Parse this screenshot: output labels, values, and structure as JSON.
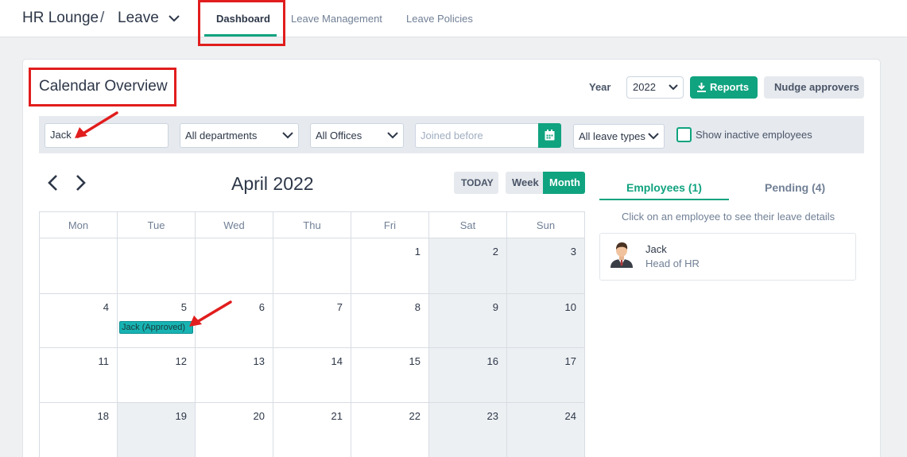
{
  "header": {
    "app_name": "HR Lounge",
    "separator": "/",
    "module": "Leave",
    "tabs": [
      {
        "label": "Dashboard",
        "active": true
      },
      {
        "label": "Leave Management",
        "active": false
      },
      {
        "label": "Leave Policies",
        "active": false
      }
    ]
  },
  "page": {
    "title": "Calendar Overview",
    "year_label": "Year",
    "year_value": "2022",
    "reports_label": "Reports",
    "nudge_label": "Nudge approvers"
  },
  "filters": {
    "search_value": "Jack",
    "department": "All departments",
    "office": "All Offices",
    "joined_placeholder": "Joined before",
    "leave_type": "All leave types",
    "inactive_label": "Show inactive employees",
    "inactive_checked": false
  },
  "calendar": {
    "month_title": "April 2022",
    "today_label": "TODAY",
    "week_label": "Week",
    "month_label": "Month",
    "view": "Month",
    "days_of_week": [
      "Mon",
      "Tue",
      "Wed",
      "Thu",
      "Fri",
      "Sat",
      "Sun"
    ],
    "weeks": [
      [
        "",
        "",
        "",
        "",
        "1",
        "2",
        "3"
      ],
      [
        "4",
        "5",
        "6",
        "7",
        "8",
        "9",
        "10"
      ],
      [
        "11",
        "12",
        "13",
        "14",
        "15",
        "16",
        "17"
      ],
      [
        "18",
        "19",
        "20",
        "21",
        "22",
        "23",
        "24"
      ]
    ],
    "events": [
      {
        "day": "5",
        "label": "Jack (Approved)"
      }
    ]
  },
  "panel": {
    "employees_tab": "Employees (1)",
    "pending_tab": "Pending (4)",
    "hint": "Click on an employee to see their leave details",
    "employee": {
      "name": "Jack",
      "role": "Head of HR"
    }
  },
  "colors": {
    "accent": "#10a37f",
    "event": "#17b3b3",
    "annotation": "#e11d1d"
  },
  "icons": [
    "chevron-down-icon",
    "download-icon",
    "calendar-icon",
    "chevron-left-icon",
    "chevron-right-icon",
    "avatar-icon",
    "red-arrow-annotation"
  ]
}
